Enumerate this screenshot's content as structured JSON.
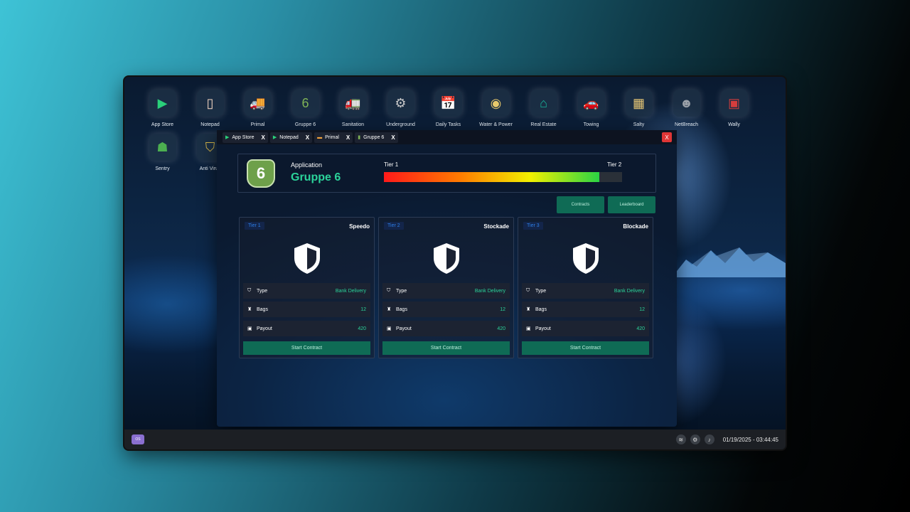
{
  "desktop": {
    "icons_row1": [
      {
        "label": "App Store",
        "icon": "play-triangle-icon",
        "glyph": "▶",
        "color": "#2ad07a"
      },
      {
        "label": "Notepad",
        "icon": "notepad-icon",
        "glyph": "▯",
        "color": "#f4d6c2"
      },
      {
        "label": "Primal",
        "icon": "truck-icon",
        "glyph": "🚚",
        "color": "#f2a23c"
      },
      {
        "label": "Gruppe 6",
        "icon": "gruppe6-shield-icon",
        "glyph": "6",
        "color": "#7fb356"
      },
      {
        "label": "Sanitation",
        "icon": "garbage-truck-icon",
        "glyph": "🚛",
        "color": "#6acb3a"
      },
      {
        "label": "Underground",
        "icon": "turbo-icon",
        "glyph": "⚙",
        "color": "#c8c8c8"
      },
      {
        "label": "Daily Tasks",
        "icon": "calendar-check-icon",
        "glyph": "📅",
        "color": "#e05a5a"
      },
      {
        "label": "Water & Power",
        "icon": "water-power-seal-icon",
        "glyph": "◉",
        "color": "#e8c96b"
      },
      {
        "label": "Real Estate",
        "icon": "house-icon",
        "glyph": "⌂",
        "color": "#17b59a"
      },
      {
        "label": "Towing",
        "icon": "tow-truck-icon",
        "glyph": "🚗",
        "color": "#e83b3b"
      },
      {
        "label": "Salty",
        "icon": "salty-icon",
        "glyph": "▦",
        "color": "#e3c474"
      },
      {
        "label": "NetBreach",
        "icon": "mask-icon",
        "glyph": "☻",
        "color": "#9aa0a8"
      },
      {
        "label": "Wally",
        "icon": "wallet-icon",
        "glyph": "▣",
        "color": "#d63d3d"
      }
    ],
    "icons_row2": [
      {
        "label": "Sentry",
        "icon": "sentry-agent-icon",
        "glyph": "☗",
        "color": "#4caf50"
      },
      {
        "label": "Anti Virus",
        "icon": "antivirus-shield-icon",
        "glyph": "⛉",
        "color": "#d9b84a"
      }
    ]
  },
  "taskbar": {
    "clock": "01/19/2025 - 03:44:45",
    "start_label": "OS"
  },
  "window": {
    "tabs": [
      {
        "label": "App Store",
        "close": "X"
      },
      {
        "label": "Notepad",
        "close": "X"
      },
      {
        "label": "Primal",
        "close": "X"
      },
      {
        "label": "Gruppe 6",
        "close": "X"
      }
    ],
    "close_label": "X",
    "header": {
      "caption": "Application",
      "app_name": "Gruppe 6",
      "logo_glyph": "6",
      "tier_start": "Tier 1",
      "tier_end": "Tier 2",
      "progress": 0.905
    },
    "buttons": {
      "contracts": "Contracts",
      "leaderboard": "Leaderboard"
    },
    "cards": [
      {
        "tier": "Tier 1",
        "title": "Speedo",
        "type_label": "Type",
        "type_value": "Bank Delivery",
        "bags_label": "Bags",
        "bags_value": "12",
        "payout_label": "Payout",
        "payout_value": "420",
        "button": "Start Contract"
      },
      {
        "tier": "Tier 2",
        "title": "Stockade",
        "type_label": "Type",
        "type_value": "Bank Delivery",
        "bags_label": "Bags",
        "bags_value": "12",
        "payout_label": "Payout",
        "payout_value": "420",
        "button": "Start Contract"
      },
      {
        "tier": "Tier 3",
        "title": "Blockade",
        "type_label": "Type",
        "type_value": "Bank Delivery",
        "bags_label": "Bags",
        "bags_value": "12",
        "payout_label": "Payout",
        "payout_value": "420",
        "button": "Start Contract"
      }
    ]
  }
}
